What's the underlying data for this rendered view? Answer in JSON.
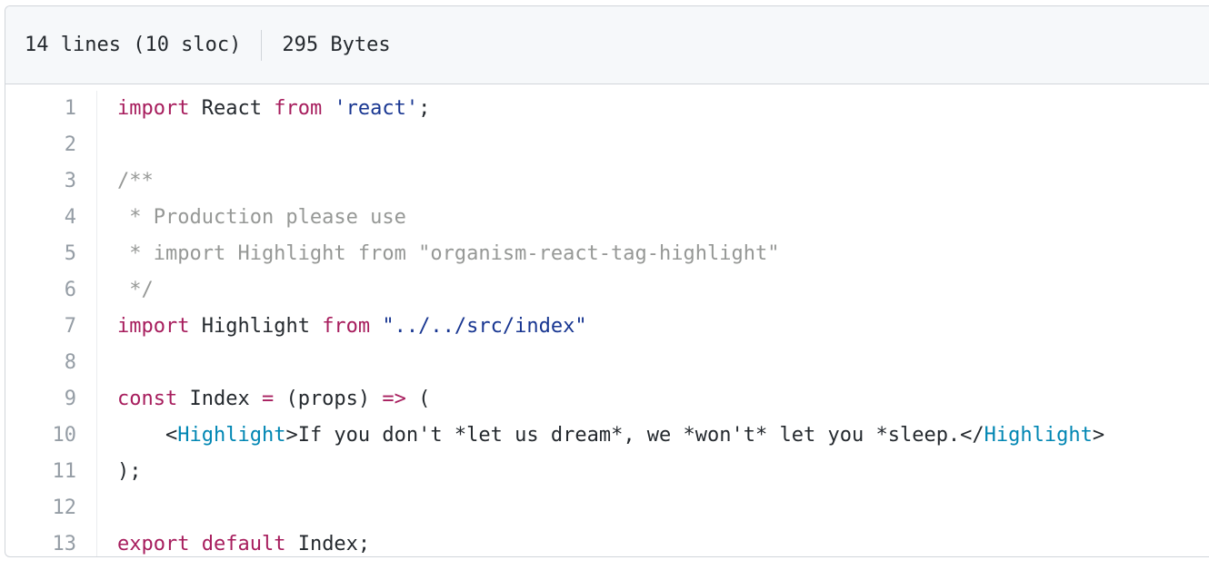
{
  "file_info": {
    "lines_label": "14 lines (10 sloc)",
    "size_label": "295 Bytes"
  },
  "colors": {
    "keyword": "#a71d5d",
    "string": "#183691",
    "comment": "#969896",
    "tag": "#0086b3",
    "text": "#24292e",
    "line_number": "#959da5"
  },
  "code_lines": [
    {
      "number": "1",
      "tokens": [
        {
          "t": "kw",
          "v": "import"
        },
        {
          "t": "pl",
          "v": " React "
        },
        {
          "t": "kw",
          "v": "from"
        },
        {
          "t": "pl",
          "v": " "
        },
        {
          "t": "str",
          "v": "'react'"
        },
        {
          "t": "pl",
          "v": ";"
        }
      ]
    },
    {
      "number": "2",
      "tokens": []
    },
    {
      "number": "3",
      "tokens": [
        {
          "t": "cmt",
          "v": "/**"
        }
      ]
    },
    {
      "number": "4",
      "tokens": [
        {
          "t": "cmt",
          "v": " * Production please use"
        }
      ]
    },
    {
      "number": "5",
      "tokens": [
        {
          "t": "cmt",
          "v": " * import Highlight from \"organism-react-tag-highlight\""
        }
      ]
    },
    {
      "number": "6",
      "tokens": [
        {
          "t": "cmt",
          "v": " */"
        }
      ]
    },
    {
      "number": "7",
      "tokens": [
        {
          "t": "kw",
          "v": "import"
        },
        {
          "t": "pl",
          "v": " Highlight "
        },
        {
          "t": "kw",
          "v": "from"
        },
        {
          "t": "pl",
          "v": " "
        },
        {
          "t": "str",
          "v": "\"../../src/index\""
        }
      ]
    },
    {
      "number": "8",
      "tokens": []
    },
    {
      "number": "9",
      "tokens": [
        {
          "t": "kw",
          "v": "const"
        },
        {
          "t": "pl",
          "v": " Index "
        },
        {
          "t": "kw",
          "v": "="
        },
        {
          "t": "pl",
          "v": " (props) "
        },
        {
          "t": "kw",
          "v": "=>"
        },
        {
          "t": "pl",
          "v": " ("
        }
      ]
    },
    {
      "number": "10",
      "tokens": [
        {
          "t": "pl",
          "v": "    <"
        },
        {
          "t": "tag",
          "v": "Highlight"
        },
        {
          "t": "pl",
          "v": ">If you don't *let us dream*, we *won't* let you *sleep.</"
        },
        {
          "t": "tag",
          "v": "Highlight"
        },
        {
          "t": "pl",
          "v": ">"
        }
      ]
    },
    {
      "number": "11",
      "tokens": [
        {
          "t": "pl",
          "v": ");"
        }
      ]
    },
    {
      "number": "12",
      "tokens": []
    },
    {
      "number": "13",
      "tokens": [
        {
          "t": "kw",
          "v": "export"
        },
        {
          "t": "pl",
          "v": " "
        },
        {
          "t": "kw",
          "v": "default"
        },
        {
          "t": "pl",
          "v": " Index;"
        }
      ]
    }
  ]
}
